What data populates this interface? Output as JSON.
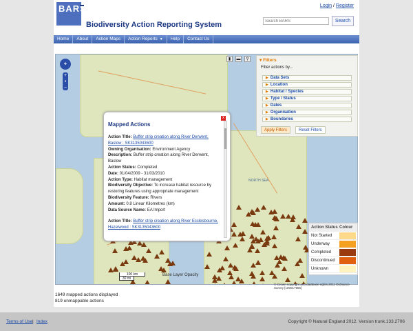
{
  "header": {
    "logo_text": "BARS",
    "title": "Biodiversity Action Reporting System",
    "login": "Login",
    "separator": "/",
    "register": "Register",
    "search_placeholder": "Search BARS",
    "search_button": "Search"
  },
  "nav": {
    "items": [
      "Home",
      "About",
      "Action Maps",
      "Action Reports",
      "Help",
      "Contact Us"
    ],
    "dropdown_caret": "▼"
  },
  "map": {
    "sea_label": "NORTH SEA",
    "scale_top": "100 km",
    "scale_bottom": "30 mi",
    "opacity_label": "Base Layer Opacity",
    "copyright": "© Crown copyright and database rights 2011 Ordnance Survey [100017955]"
  },
  "filters": {
    "title": "Filters",
    "subtitle": "Filter actions by...",
    "items": [
      "Data Sets",
      "Location",
      "Habitat / Species",
      "Type / Status",
      "Dates",
      "Organisation",
      "Boundaries"
    ],
    "apply": "Apply Filters",
    "reset": "Reset Filters"
  },
  "popup": {
    "title": "Mapped Actions",
    "close": "x",
    "record1": {
      "action_title_label": "Action Title:",
      "action_title": "Buffer strip creation along River Derwent, Baslow : SK3135043600",
      "owner_label": "Owning Organisation:",
      "owner": "Environment Agency",
      "desc_label": "Description:",
      "desc": "Buffer strip creation along River Derwent, Baslow",
      "status_label": "Action Status:",
      "status": "Completed",
      "date_label": "Date:",
      "date": "01/04/2009 - 31/03/2010",
      "type_label": "Action Type:",
      "type": "Habitat management",
      "objective_label": "Biodiversity Objective:",
      "objective": "To increase habitat resource by restoring features using appropriate management",
      "feature_label": "Biodiversity Feature:",
      "feature": "Rivers",
      "amount_label": "Amount:",
      "amount": "0.8 Linear Kilometres (km)",
      "source_label": "Data Source Name:",
      "source": "EA Import"
    },
    "record2": {
      "action_title_label": "Action Title:",
      "action_title": "Buffer strip creation along River Ecclesbourne, Hazelwood : SK3135043600"
    }
  },
  "legend": {
    "head_status": "Action Status",
    "head_colour": "Colour",
    "rows": [
      {
        "label": "Not Started",
        "color": "#ffd98a"
      },
      {
        "label": "Underway",
        "color": "#f5a020"
      },
      {
        "label": "Completed",
        "color": "#9a3a10"
      },
      {
        "label": "Discontinued",
        "color": "#e06010"
      },
      {
        "label": "Unknown",
        "color": "#fff3c0"
      }
    ]
  },
  "stats": {
    "mapped": "1649 mapped actions displayed",
    "unmappable": "819 unmappable actions"
  },
  "footer": {
    "terms": "Terms of Use",
    "separator": "|",
    "index": "Index",
    "copyright": "Copyright © Natural England 2012. Version trunk.133.2706"
  }
}
